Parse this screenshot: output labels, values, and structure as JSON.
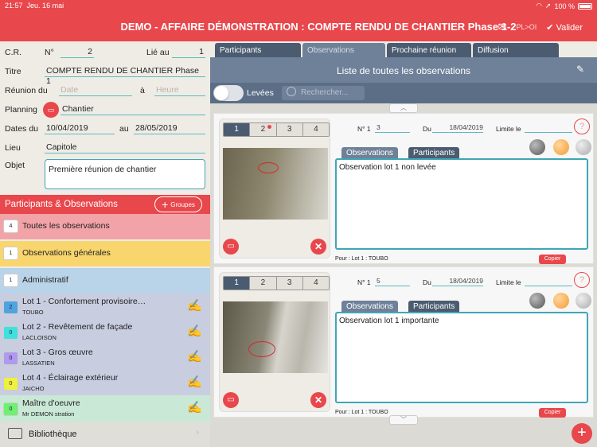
{
  "status": {
    "time": "21:57",
    "date": "Jeu. 16 mai",
    "battery": "100 %"
  },
  "nav": {
    "title": "DEMO - AFFAIRE DÉMONSTRATION : COMPTE RENDU DE CHANTIER Phase 1-2",
    "pl_label": "PL>OI",
    "valider": "Valider"
  },
  "form": {
    "cr_label": "C.R.",
    "no_label": "N°",
    "no_value": "2",
    "lie_label": "Lié au",
    "lie_value": "1",
    "titre_label": "Titre",
    "titre_value": "COMPTE RENDU DE CHANTIER Phase 1",
    "reunion_label": "Réunion du",
    "date_ph": "Date",
    "a_label": "à",
    "heure_ph": "Heure",
    "planning_label": "Planning",
    "planning_value": "Chantier",
    "dates_label": "Dates du",
    "date_start": "10/04/2019",
    "au_label": "au",
    "date_end": "28/05/2019",
    "lieu_label": "Lieu",
    "lieu_value": "Capitole",
    "objet_label": "Objet",
    "objet_value": "Première réunion de chantier"
  },
  "participants": {
    "title": "Participants & Observations",
    "groupes": "Groupes",
    "items": [
      {
        "count": "4",
        "name": "Toutes les observations",
        "sub": "",
        "color": "#f2a3a7",
        "badge": "#ffffff"
      },
      {
        "count": "1",
        "name": "Observations générales",
        "sub": "",
        "color": "#f9d56e",
        "badge": "#ffffff"
      },
      {
        "count": "1",
        "name": "Administratif",
        "sub": "",
        "color": "#b9d4e8",
        "badge": "#ffffff"
      },
      {
        "count": "2",
        "name": "Lot 1 - Confortement provisoire…",
        "sub": "TOUBO",
        "color": "#c9cde0",
        "badge": "#4fa3e0"
      },
      {
        "count": "0",
        "name": "Lot 2 - Revêtement de façade",
        "sub": "LACLOISON",
        "color": "#c9cde0",
        "badge": "#3fe0e0"
      },
      {
        "count": "0",
        "name": "Lot 3 - Gros œuvre",
        "sub": "LASSATIEN",
        "color": "#c9cde0",
        "badge": "#b09af0"
      },
      {
        "count": "0",
        "name": "Lot 4 - Éclairage extérieur",
        "sub": "JAICHO",
        "color": "#c9cde0",
        "badge": "#f0f040"
      },
      {
        "count": "0",
        "name": "Maître d'oeuvre",
        "sub": "Mr DEMON stration",
        "color": "#c9e8d6",
        "badge": "#6ef070"
      }
    ]
  },
  "biblio": {
    "label": "Bibliothèque"
  },
  "tabs": [
    "Participants",
    "Observations",
    "Prochaine réunion",
    "Diffusion"
  ],
  "list": {
    "title": "Liste de toutes les observations",
    "levees": "Levées",
    "search_ph": "Rechercher..."
  },
  "observations": [
    {
      "tabs": [
        "1",
        "2",
        "3",
        "4"
      ],
      "no_label": "N° 1",
      "no_value": "3",
      "du_label": "Du",
      "du_value": "18/04/2019",
      "limite_label": "Limite le",
      "limite_value": "",
      "tab_obs": "Observations",
      "tab_part": "Participants",
      "text": "Observation lot 1 non levée",
      "pour": "Pour :   Lot 1 : TOUBO",
      "copier": "Copier"
    },
    {
      "tabs": [
        "1",
        "2",
        "3",
        "4"
      ],
      "no_label": "N° 1",
      "no_value": "5",
      "du_label": "Du",
      "du_value": "18/04/2019",
      "limite_label": "Limite le",
      "limite_value": "",
      "tab_obs": "Observations",
      "tab_part": "Participants",
      "text": "Observation lot 1 importante",
      "pour": "Pour :   Lot 1 : TOUBO",
      "copier": "Copier"
    }
  ],
  "colors": {
    "accent": "#e8474c",
    "teal": "#3fa6b5",
    "slate": "#4b5c71"
  }
}
